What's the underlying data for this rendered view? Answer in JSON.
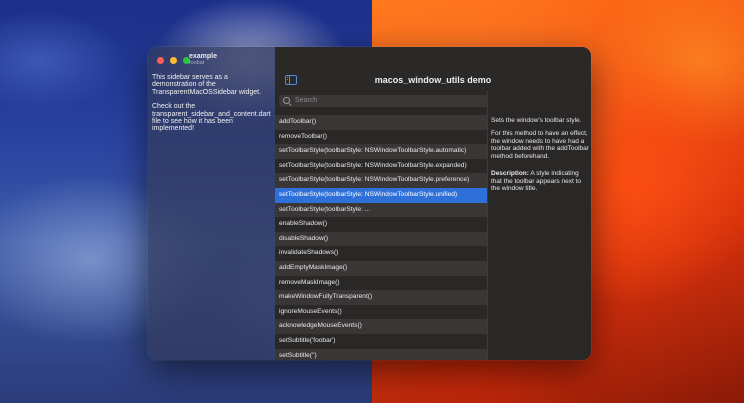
{
  "app": {
    "name": "example",
    "subtitle": "foobar",
    "window_title": "macos_window_utils demo"
  },
  "sidebar": {
    "paragraph1": "This sidebar serves as a demonstration of the TransparentMacOSSidebar widget.",
    "paragraph2": "Check out the transparent_sidebar_and_content.dart file to see how it has been implemented!"
  },
  "search": {
    "placeholder": "Search"
  },
  "methods": [
    "addToolbar()",
    "removeToolbar()",
    "setToolbarStyle(toolbarStyle: NSWindowToolbarStyle.automatic)",
    "setToolbarStyle(toolbarStyle: NSWindowToolbarStyle.expanded)",
    "setToolbarStyle(toolbarStyle: NSWindowToolbarStyle.preference)",
    "setToolbarStyle(toolbarStyle: NSWindowToolbarStyle.unified)",
    "setToolbarStyle(toolbarStyle: ...",
    "enableShadow()",
    "disableShadow()",
    "invalidateShadows()",
    "addEmptyMaskImage()",
    "removeMaskImage()",
    "makeWindowFullyTransparent()",
    "ignoreMouseEvents()",
    "acknowledgeMouseEvents()",
    "setSubtitle('foobar')",
    "setSubtitle('')"
  ],
  "selected_index": 5,
  "detail": {
    "summary": "Sets the window's toolbar style.",
    "body": "For this method to have an effect, the window needs to have had a toolbar added with the addToolbar method beforehand.",
    "description_label": "Description:",
    "description_text": " A style indicating that the toolbar appears next to the window title."
  },
  "colors": {
    "accent": "#2f6fd8",
    "close": "#ff5f57",
    "minimize": "#febc2e",
    "zoom": "#28c840"
  }
}
